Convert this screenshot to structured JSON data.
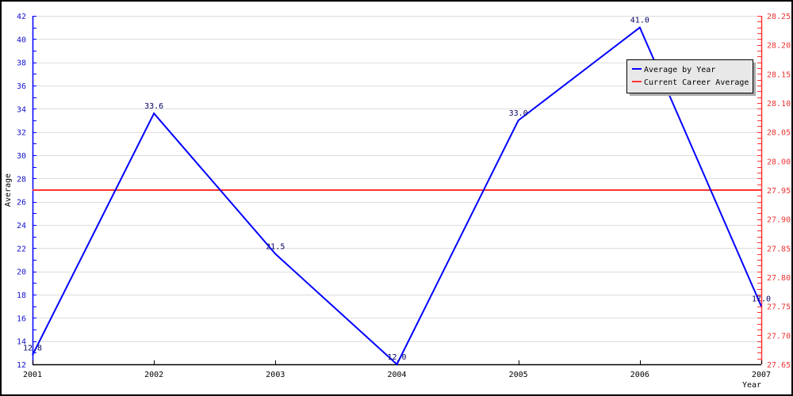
{
  "chart_data": {
    "type": "line",
    "title": "",
    "xlabel": "Year",
    "ylabel": "Average",
    "categories": [
      "2001",
      "2002",
      "2003",
      "2004",
      "2005",
      "2006",
      "2007"
    ],
    "series": [
      {
        "name": "Average by Year",
        "axis": "left",
        "color": "#0000ff",
        "values": [
          12.8,
          33.6,
          21.5,
          12.0,
          33.0,
          41.0,
          17.0
        ],
        "data_labels": [
          "12.8",
          "33.6",
          "21.5",
          "12.0",
          "33.0",
          "41.0",
          "17.0"
        ]
      },
      {
        "name": "Current Career Average",
        "axis": "right",
        "color": "#ff3333",
        "value": 27.95
      }
    ],
    "y_left": {
      "range": [
        12,
        42
      ],
      "major_step": 2,
      "minor_step": 1,
      "color": "#0000ff",
      "tick_labels": [
        "12",
        "14",
        "16",
        "18",
        "20",
        "22",
        "24",
        "26",
        "28",
        "30",
        "32",
        "34",
        "36",
        "38",
        "40",
        "42"
      ]
    },
    "y_right": {
      "range": [
        27.65,
        28.25
      ],
      "major_step": 0.05,
      "minor_step": 0.01,
      "color": "#ff3333",
      "tick_labels": [
        "27.65",
        "27.70",
        "27.75",
        "27.80",
        "27.85",
        "27.90",
        "27.95",
        "28.00",
        "28.05",
        "28.10",
        "28.15",
        "28.20",
        "28.25"
      ]
    },
    "grid": true,
    "legend": {
      "position": "top-right",
      "entries": [
        {
          "label": "Average by Year",
          "color": "#0000ff"
        },
        {
          "label": "Current Career Average",
          "color": "#ff3333"
        }
      ]
    }
  }
}
